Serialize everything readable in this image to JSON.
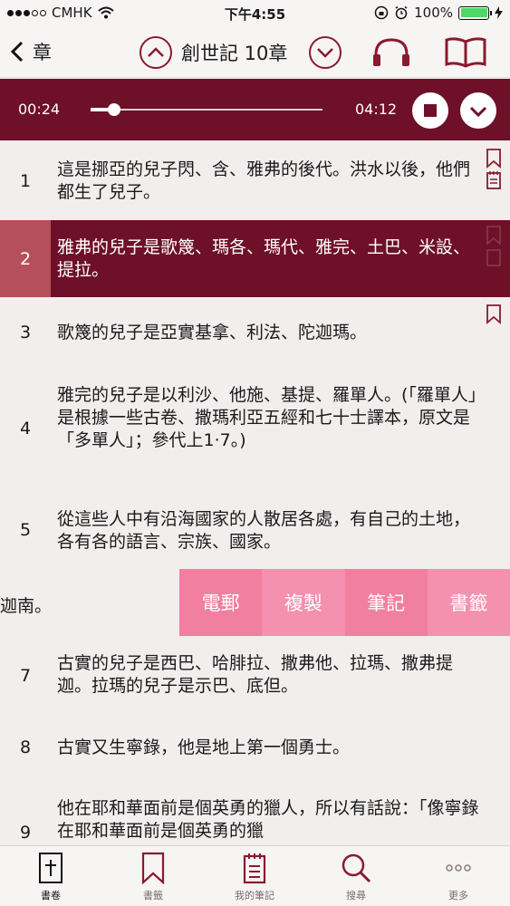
{
  "status_bar": {
    "carrier": "CMHK",
    "time": "下午4:55",
    "battery": "100%",
    "battery_level": 1.0
  },
  "nav": {
    "back_label": "章",
    "title": "創世記 10章"
  },
  "audio": {
    "elapsed": "00:24",
    "duration": "04:12",
    "progress": 0.1
  },
  "verses": [
    {
      "num": "1",
      "text": "這是挪亞的兒子閃、含、雅弗的後代。洪水以後，他們都生了兒子。"
    },
    {
      "num": "2",
      "text": "雅弗的兒子是歌篾、瑪各、瑪代、雅完、土巴、米設、提拉。"
    },
    {
      "num": "3",
      "text": "歌篾的兒子是亞實基拿、利法、陀迦瑪。"
    },
    {
      "num": "4",
      "text": "雅完的兒子是以利沙、他施、基提、羅單人。(「羅單人」是根據一些古卷、撒瑪利亞五經和七十士譯本，原文是「多單人」；參代上1·7。)"
    },
    {
      "num": "5",
      "text": "從這些人中有沿海國家的人散居各處，有自己的土地，各有各的語言、宗族、國家。"
    },
    {
      "num": "7",
      "text": "古實的兒子是西巴、哈腓拉、撒弗他、拉瑪、撒弗提迦。拉瑪的兒子是示巴、底但。"
    },
    {
      "num": "8",
      "text": "古實又生寧錄，他是地上第一個勇士。"
    },
    {
      "num": "9",
      "text": "他在耶和華面前是個英勇的獵人，所以有話說：「像寧錄在耶和華面前是個英勇的獵"
    }
  ],
  "partial_text": "迦南。",
  "context_menu": {
    "items": [
      "電郵",
      "複製",
      "筆記",
      "書籤"
    ]
  },
  "tabs": [
    "書卷",
    "書籤",
    "我的筆記",
    "搜尋",
    "更多"
  ],
  "colors": {
    "accent": "#6e1028",
    "highlight_number": "#b5505b",
    "menu_pink_1": "#f07fa0",
    "menu_pink_2": "#f490b0"
  }
}
